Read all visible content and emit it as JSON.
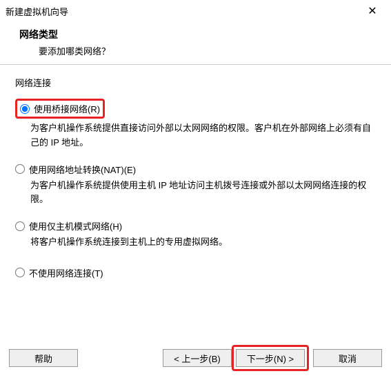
{
  "window": {
    "title": "新建虚拟机向导",
    "close": "✕"
  },
  "header": {
    "heading": "网络类型",
    "subheading": "要添加哪类网络？"
  },
  "group": {
    "label": "网络连接"
  },
  "options": {
    "bridged": {
      "label": "使用桥接网络(R)",
      "desc": "为客户机操作系统提供直接访问外部以太网网络的权限。客户机在外部网络上必须有自己的 IP 地址。"
    },
    "nat": {
      "label": "使用网络地址转换(NAT)(E)",
      "desc": "为客户机操作系统提供使用主机 IP 地址访问主机拨号连接或外部以太网网络连接的权限。"
    },
    "hostonly": {
      "label": "使用仅主机模式网络(H)",
      "desc": "将客户机操作系统连接到主机上的专用虚拟网络。"
    },
    "none": {
      "label": "不使用网络连接(T)"
    }
  },
  "buttons": {
    "help": "帮助",
    "back": "< 上一步(B)",
    "next": "下一步(N) >",
    "cancel": "取消"
  }
}
